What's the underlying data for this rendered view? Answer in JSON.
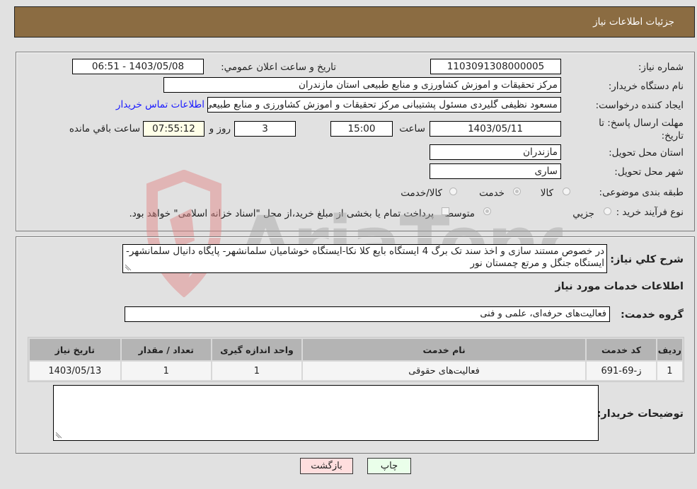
{
  "header": {
    "title": "جزئیات اطلاعات نیاز"
  },
  "details": {
    "need_number_label": "شماره نیاز:",
    "need_number": "1103091308000005",
    "announce_label": "تاریخ و ساعت اعلان عمومي:",
    "announce_value": "1403/05/08 - 06:51",
    "buyer_org_label": "نام دستگاه خریدار:",
    "buyer_org": "مرکز تحقیقات و اموزش کشاورزی و منابع طبیعی استان مازندران",
    "creator_label": "ایجاد کننده درخواست:",
    "creator": "مسعود نظیفی گلیردی مسئول پشتیبانی مرکز تحقیقات و اموزش کشاورزی و منابع طبیعی استان مازندران",
    "contact_link": "اطلاعات تماس خریدار",
    "deadline_label": "مهلت ارسال پاسخ: تا تاریخ:",
    "deadline_date": "1403/05/11",
    "time_label": "ساعت",
    "deadline_time": "15:00",
    "days_value": "3",
    "days_label": "روز و",
    "remaining_time": "07:55:12",
    "remaining_label": "ساعت باقي مانده",
    "province_label": "استان محل تحویل:",
    "province": "مازندران",
    "city_label": "شهر محل تحویل:",
    "city": "ساری",
    "category_label": "طبقه بندی موضوعی:",
    "category_options": [
      {
        "label": "کالا",
        "checked": false
      },
      {
        "label": "خدمت",
        "checked": true
      },
      {
        "label": "کالا/خدمت",
        "checked": false
      }
    ],
    "process_label": "نوع فرآیند خرید :",
    "process_options": [
      {
        "label": "جزيي",
        "checked": false
      },
      {
        "label": "متوسط",
        "checked": true
      }
    ],
    "treasury_note": "پرداخت تمام یا بخشی از مبلغ خرید،از محل \"اسناد خزانه اسلامی\" خواهد بود.",
    "treasury_checked": false
  },
  "description": {
    "label": "شرح کلي نیاز:",
    "text": "در خصوص مستند سازی و اخذ سند تک برگ 4 ایستگاه بایع کلا نکا-ایستگاه خوشامیان سلمانشهر- پایگاه دانیال سلمانشهر- ایستگاه جنگل و مرتع چمستان نور"
  },
  "services": {
    "section_title": "اطلاعات خدمات مورد نیاز",
    "group_label": "گروه خدمت:",
    "group_value": "فعالیت‌های حرفه‌ای، علمی و فنی",
    "table": {
      "headers": [
        "ردیف",
        "کد خدمت",
        "نام خدمت",
        "واحد اندازه گیری",
        "تعداد / مقدار",
        "تاریخ نیاز"
      ],
      "rows": [
        [
          "1",
          "ز-69-691",
          "فعالیت‌های حقوقی",
          "1",
          "1",
          "1403/05/13"
        ]
      ]
    }
  },
  "buyer_notes": {
    "label": "توضیحات خریدار:",
    "value": ""
  },
  "buttons": {
    "print": "چاپ",
    "back": "بازگشت"
  },
  "watermark": {
    "text": "AriaTender.neT"
  },
  "colors": {
    "header_bg": "#8b6c42",
    "print_bg": "#eaffea",
    "back_bg": "#ffdede",
    "link": "#1a1aff"
  }
}
